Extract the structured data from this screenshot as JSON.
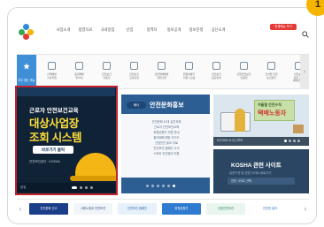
{
  "header": {
    "nav": [
      "사업소개",
      "법령자료",
      "국내방침",
      "산업",
      "정책자",
      "정보공개",
      "정보문쟁",
      "공단소개"
    ],
    "login_badge": "전체메뉴 보기"
  },
  "quickbar": {
    "first_label": "자주 찾는 메뉴",
    "items": [
      "산재예방\n기술지원",
      "중대재해\n알리미",
      "안전보건\n자료실",
      "안전보건\n교육신청",
      "산업재해예방\n지원사업",
      "위험성평가\n지원시스템",
      "안전보건\n공단안내",
      "산업안전보건\n인증원",
      "건설업 안전\n보건관리",
      "안전보건\n직무 교육\n배워보세요"
    ],
    "next_glyph": "›"
  },
  "main_banner": {
    "caption": "근로자 안전보건교육",
    "title_line1": "대상사업장",
    "title_line2": "조회 시스템",
    "button_label": "바로가기 클릭",
    "logos_text": "안전보건공단  ·  KOSHA",
    "footer_label": "알림",
    "dots": 4,
    "active_dot": 1
  },
  "promo": {
    "tag": "배너",
    "title": "안전문화홍보",
    "lines": [
      "안전문화 10대 실천과제",
      "근로자 안전보건교육",
      "위험성평가 지원 안내",
      "중대재해 예방 가이드",
      "산업안전 홍보 자료",
      "안전보건 캠페인 소식",
      "스마트 안전장비 지원"
    ],
    "dots": 6,
    "active_dot": 6
  },
  "right_card": {
    "sign_line1": "겨울철 안전수칙",
    "sign_line2": "택배노동자",
    "footer_label": "KOSHA 소식 | 보도",
    "dots": 4,
    "active_dot": 1
  },
  "kosha_card": {
    "title": "KOSHA 관련 사이트",
    "subtitle": "유관기관 및 관련 사이트 바로가기",
    "select_value": "관련 사이트 선택"
  },
  "strip": {
    "prev_glyph": "‹",
    "next_glyph": "›",
    "logos": [
      {
        "text": "안전문화 신고",
        "bg": "#1b3e8a",
        "fg": "#ffffff"
      },
      {
        "text": "고용노동부 안전보건",
        "bg": "#f1f5fa",
        "fg": "#2a4a7a"
      },
      {
        "text": "안전보건 캠페인",
        "bg": "#e7f1fb",
        "fg": "#1e5fa8"
      },
      {
        "text": "위험성평가",
        "bg": "#2e7bcf",
        "fg": "#ffffff"
      },
      {
        "text": "산업안전보건",
        "bg": "#e9f6ef",
        "fg": "#1f7a4c"
      },
      {
        "text": "안전한 일터",
        "bg": "#ffffff",
        "fg": "#2c6fb8"
      }
    ]
  },
  "colors": {
    "highlight_border": "#c0232e",
    "banner_title": "#ffde3a",
    "promo_bg": "#2d5e93",
    "corner_badge": "#f5b400"
  },
  "corner_badge": "1"
}
